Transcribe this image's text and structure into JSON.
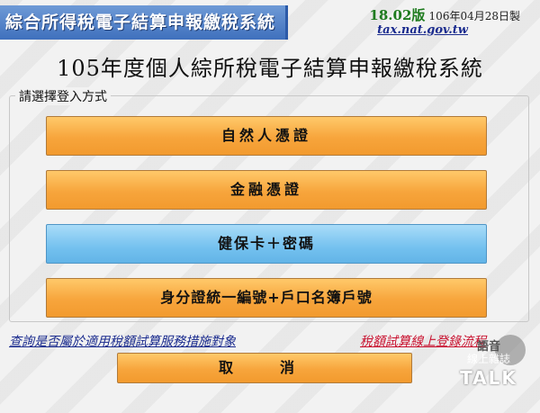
{
  "header": {
    "app_title": "綜合所得稅電子結算申報繳稅系統",
    "version": "18.02版",
    "build_date": "106年04月28日製",
    "site": "tax.nat.gov.tw"
  },
  "page_title": "105年度個人綜所稅電子結算申報繳稅系統",
  "login": {
    "legend": "請選擇登入方式",
    "buttons": {
      "citizen_cert": "自然人憑證",
      "financial_cert": "金融憑證",
      "nhi_card": "健保卡＋密碼",
      "id_household": "身分證統一編號+戶口名簿戶號"
    }
  },
  "links": {
    "eligibility": "查詢是否屬於適用稅額試算服務措施對象",
    "trial_login": "稅額試算線上登錄流程"
  },
  "cancel": "取　消",
  "watermark": {
    "line1": "語音",
    "line2": "線上雜誌",
    "line3": "TALK"
  },
  "colors": {
    "orange_button": "#f7a53c",
    "blue_button": "#74c1ef",
    "banner": "#3f70bd",
    "link_blue": "#1a2b8e",
    "link_red": "#c8102e",
    "version_green": "#1e7b1e"
  }
}
